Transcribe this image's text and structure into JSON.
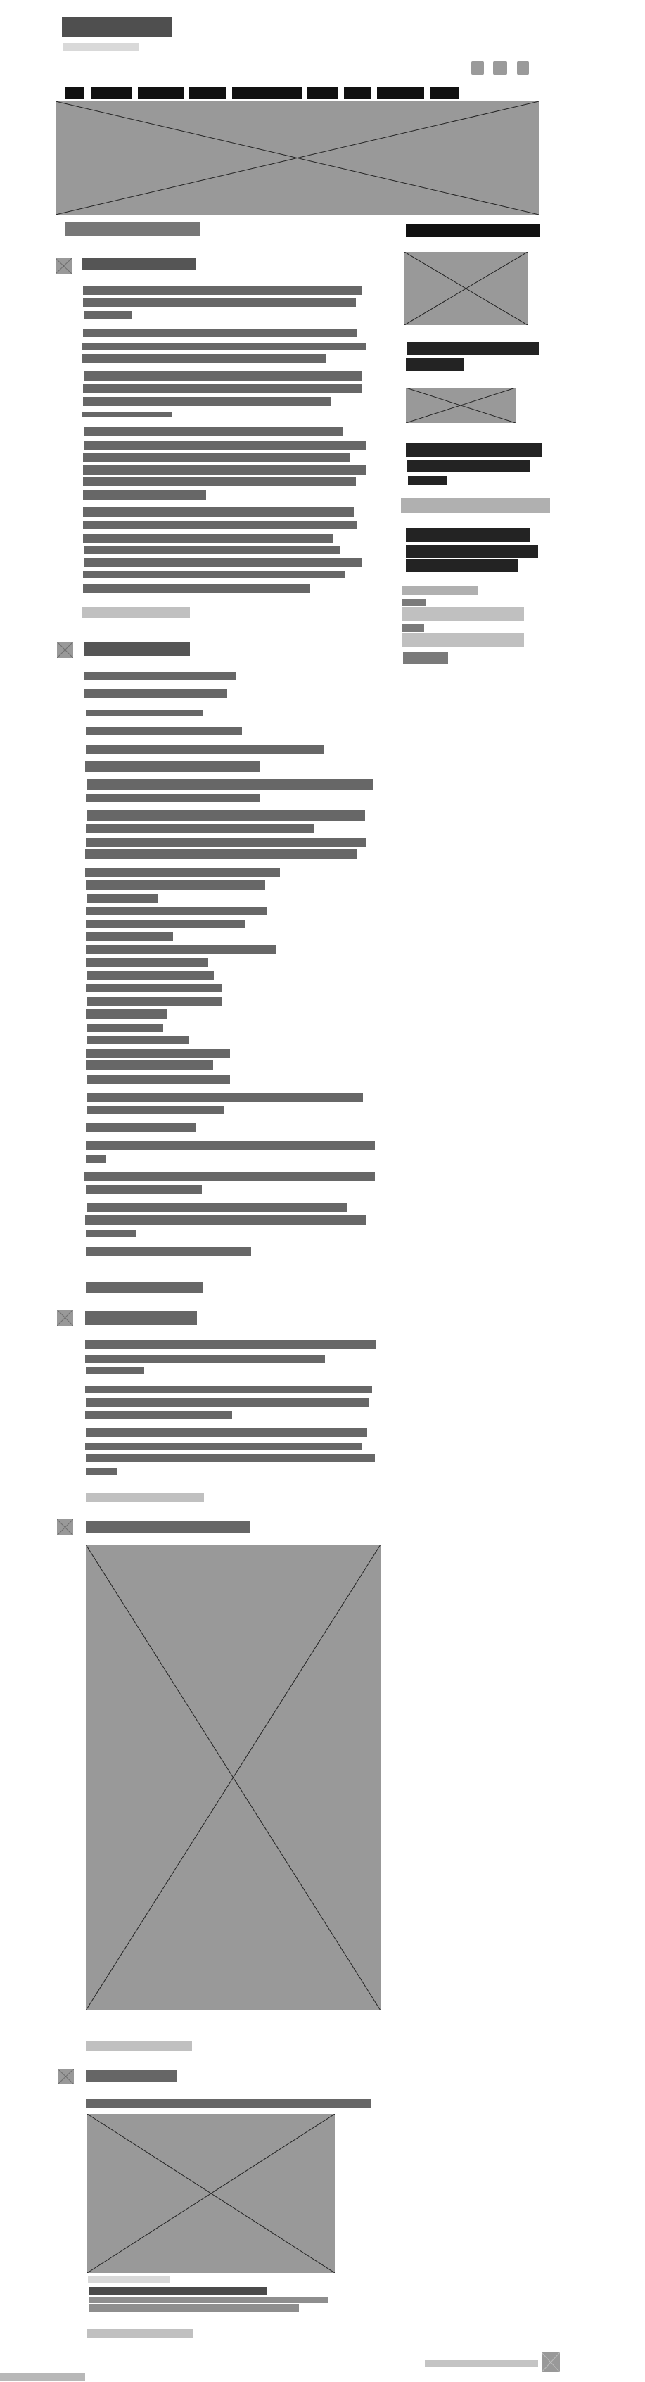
{
  "colors": {
    "logo": "#4f4f4f",
    "tagline": "#d9d9d9",
    "social": "#9a9a9a",
    "nav": "#111111",
    "placeholder": "#999999",
    "placeholder_cross": "#222222",
    "section_title": "#777777",
    "heading": "#555555",
    "heading_alt": "#666666",
    "text": "#676767",
    "link_light": "#c0c0c0",
    "sidebar_header": "#111111",
    "sidebar_dark": "#232323",
    "sidebar_band": "#b0b0b0",
    "form_label": "#7a7a7a",
    "form_input": "#c0c0c0",
    "caption": "#d8d8d8",
    "caption_title": "#4a4a4a",
    "caption_text": "#8e8e8e",
    "footer": "#c4c4c4",
    "footer_left": "#b8b8b8"
  },
  "header": {
    "nav_item_count": 9,
    "social_icons": [
      "social-icon-1",
      "social-icon-2",
      "social-icon-3"
    ]
  }
}
